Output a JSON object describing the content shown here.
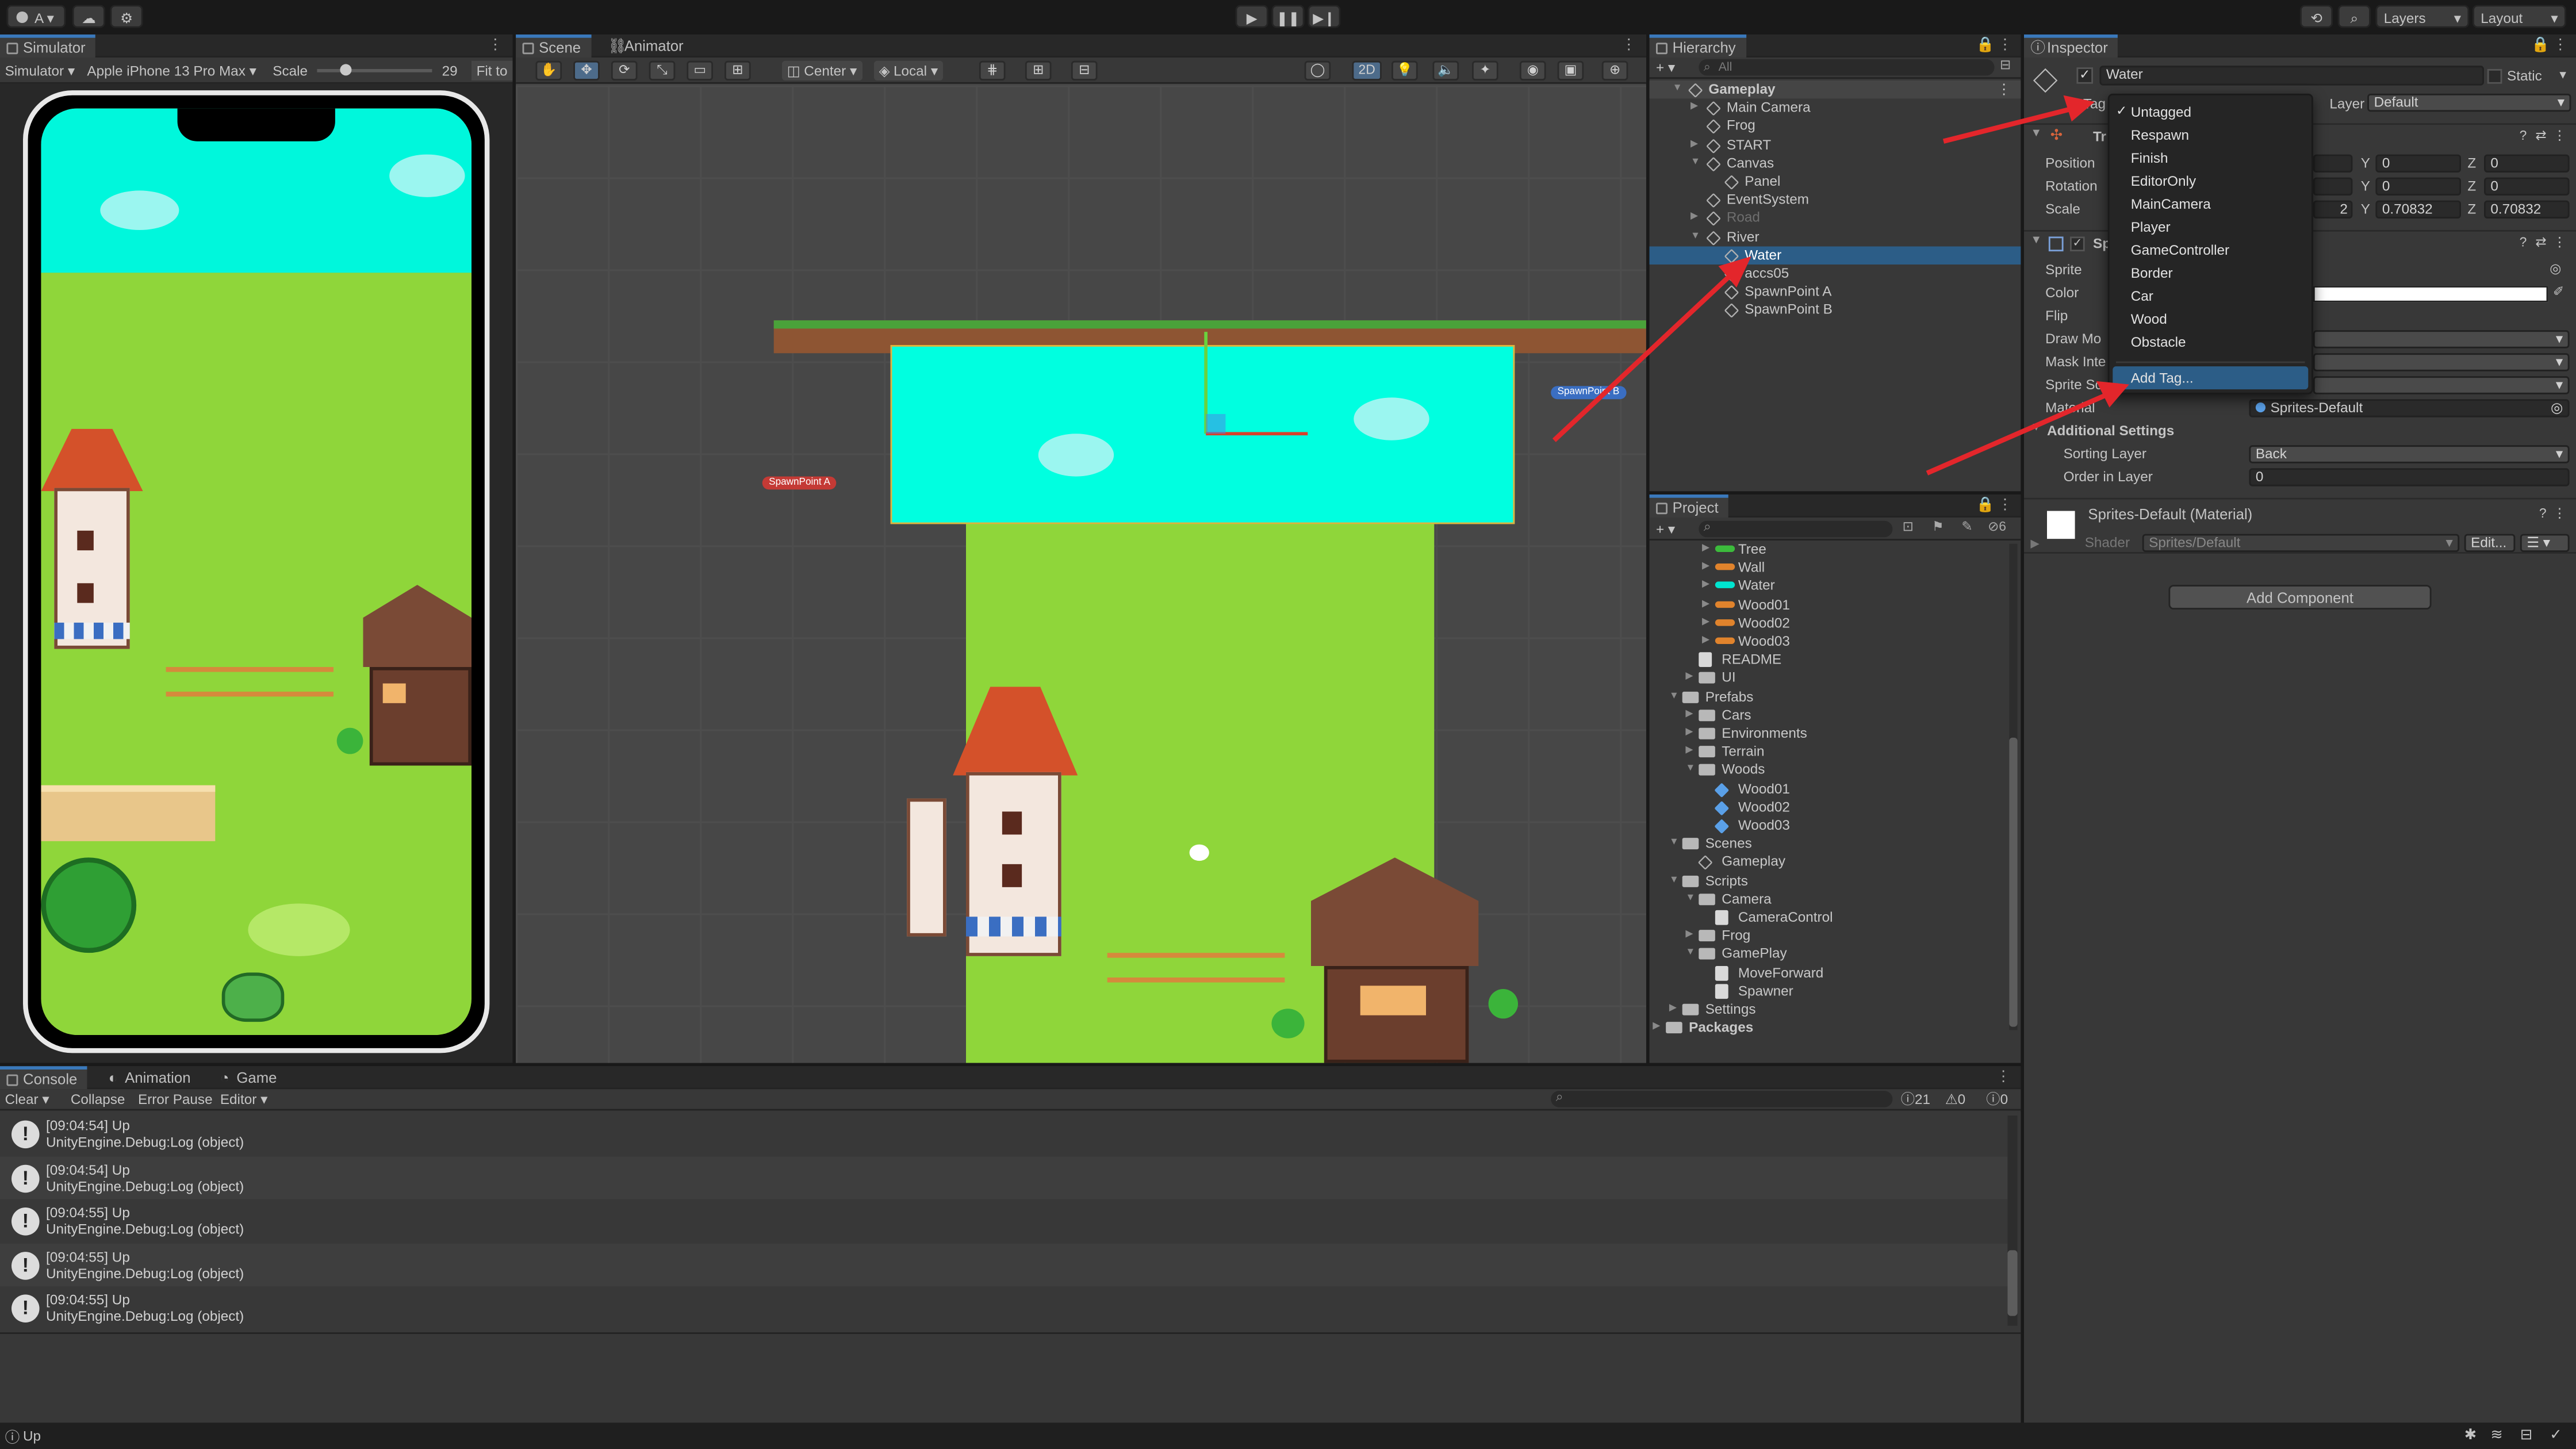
{
  "toolbar": {
    "account": "A ▾",
    "layers": "Layers",
    "layout": "Layout"
  },
  "simulator": {
    "tab": "Simulator",
    "mode": "Simulator",
    "device": "Apple iPhone 13 Pro Max",
    "scale_label": "Scale",
    "scale_value": "29",
    "fit": "Fit to"
  },
  "scene": {
    "tabs": [
      "Scene",
      "Animator"
    ],
    "pivot": "Center",
    "space": "Local",
    "mode2d": "2D",
    "spawn_a": "SpawnPoint A",
    "spawn_b": "SpawnPoint B"
  },
  "hierarchy": {
    "tab": "Hierarchy",
    "search_placeholder": "All",
    "items": [
      {
        "label": "Gameplay",
        "depth": 0,
        "arrow": "▼",
        "icon": "scene",
        "selected": false,
        "bold": true
      },
      {
        "label": "Main Camera",
        "depth": 1,
        "arrow": "▶",
        "icon": "cube"
      },
      {
        "label": "Frog",
        "depth": 1,
        "arrow": "",
        "icon": "cube"
      },
      {
        "label": "START",
        "depth": 1,
        "arrow": "▶",
        "icon": "cube"
      },
      {
        "label": "Canvas",
        "depth": 1,
        "arrow": "▼",
        "icon": "cube"
      },
      {
        "label": "Panel",
        "depth": 2,
        "arrow": "",
        "icon": "cube"
      },
      {
        "label": "EventSystem",
        "depth": 1,
        "arrow": "",
        "icon": "cube"
      },
      {
        "label": "Road",
        "depth": 1,
        "arrow": "▶",
        "icon": "cube",
        "dim": true
      },
      {
        "label": "River",
        "depth": 1,
        "arrow": "▼",
        "icon": "cube"
      },
      {
        "label": "Water",
        "depth": 2,
        "arrow": "",
        "icon": "cube",
        "selected": true
      },
      {
        "label": "accs05",
        "depth": 2,
        "arrow": "",
        "icon": "cube"
      },
      {
        "label": "SpawnPoint A",
        "depth": 2,
        "arrow": "",
        "icon": "cube"
      },
      {
        "label": "SpawnPoint B",
        "depth": 2,
        "arrow": "",
        "icon": "cube"
      }
    ]
  },
  "project": {
    "tab": "Project",
    "hidden_count": "6",
    "items": [
      {
        "label": "Tree",
        "depth": 3,
        "icon": "tree"
      },
      {
        "label": "Wall",
        "depth": 3,
        "icon": "wall"
      },
      {
        "label": "Water",
        "depth": 3,
        "icon": "water"
      },
      {
        "label": "Wood01",
        "depth": 3,
        "icon": "wood"
      },
      {
        "label": "Wood02",
        "depth": 3,
        "icon": "wood"
      },
      {
        "label": "Wood03",
        "depth": 3,
        "icon": "wood"
      },
      {
        "label": "README",
        "depth": 2,
        "icon": "file"
      },
      {
        "label": "UI",
        "depth": 2,
        "icon": "folder"
      },
      {
        "label": "Prefabs",
        "depth": 1,
        "icon": "folder"
      },
      {
        "label": "Cars",
        "depth": 2,
        "icon": "folder"
      },
      {
        "label": "Environments",
        "depth": 2,
        "icon": "folder"
      },
      {
        "label": "Terrain",
        "depth": 2,
        "icon": "folder"
      },
      {
        "label": "Woods",
        "depth": 2,
        "icon": "folder"
      },
      {
        "label": "Wood01",
        "depth": 3,
        "icon": "prefab"
      },
      {
        "label": "Wood02",
        "depth": 3,
        "icon": "prefab"
      },
      {
        "label": "Wood03",
        "depth": 3,
        "icon": "prefab"
      },
      {
        "label": "Scenes",
        "depth": 1,
        "icon": "folder"
      },
      {
        "label": "Gameplay",
        "depth": 2,
        "icon": "scene"
      },
      {
        "label": "Scripts",
        "depth": 1,
        "icon": "folder"
      },
      {
        "label": "Camera",
        "depth": 2,
        "icon": "folder"
      },
      {
        "label": "CameraControl",
        "depth": 3,
        "icon": "script"
      },
      {
        "label": "Frog",
        "depth": 2,
        "icon": "folder"
      },
      {
        "label": "GamePlay",
        "depth": 2,
        "icon": "folder"
      },
      {
        "label": "MoveForward",
        "depth": 3,
        "icon": "script"
      },
      {
        "label": "Spawner",
        "depth": 3,
        "icon": "script"
      },
      {
        "label": "Settings",
        "depth": 1,
        "icon": "folder"
      },
      {
        "label": "Packages",
        "depth": 0,
        "icon": "folder",
        "bold": true
      }
    ]
  },
  "inspector": {
    "tab": "Inspector",
    "object_name": "Water",
    "static": "Static",
    "tag_label": "Tag",
    "layer_label": "Layer",
    "layer_value": "Default",
    "transform_title": "Tr",
    "position_label": "Position",
    "rotation_label": "Rotation",
    "scale_label": "Scale",
    "pos": {
      "y": "0",
      "z": "0"
    },
    "rot": {
      "y": "0",
      "z": "0"
    },
    "scl": {
      "x_tail": "2",
      "y": "0.70832",
      "z": "0.70832"
    },
    "sprite_title": "Sp",
    "sprite_label": "Sprite",
    "color_label": "Color",
    "flip_label": "Flip",
    "draw_mode_label": "Draw Mo",
    "mask_label": "Mask Inte",
    "sort_label": "Sprite So",
    "material_label": "Material",
    "material_value": "Sprites-Default",
    "additional": "Additional Settings",
    "sorting_layer_label": "Sorting Layer",
    "sorting_layer_value": "Back",
    "order_label": "Order in Layer",
    "order_value": "0",
    "mat_title": "Sprites-Default (Material)",
    "shader_label": "Shader",
    "shader_value": "Sprites/Default",
    "edit": "Edit...",
    "add_component": "Add Component"
  },
  "tag_dropdown": {
    "items": [
      "Untagged",
      "Respawn",
      "Finish",
      "EditorOnly",
      "MainCamera",
      "Player",
      "GameController",
      "Border",
      "Car",
      "Wood",
      "Obstacle"
    ],
    "checked": "Untagged",
    "add": "Add Tag..."
  },
  "console": {
    "tabs": [
      "Console",
      "Animation",
      "Game"
    ],
    "clear": "Clear",
    "collapse": "Collapse",
    "error_pause": "Error Pause",
    "editor": "Editor",
    "counts": {
      "log": "21",
      "warn": "0",
      "error": "0"
    },
    "entries": [
      {
        "time": "[09:04:54] Up",
        "source": "UnityEngine.Debug:Log (object)"
      },
      {
        "time": "[09:04:54] Up",
        "source": "UnityEngine.Debug:Log (object)"
      },
      {
        "time": "[09:04:55] Up",
        "source": "UnityEngine.Debug:Log (object)"
      },
      {
        "time": "[09:04:55] Up",
        "source": "UnityEngine.Debug:Log (object)"
      },
      {
        "time": "[09:04:55] Up",
        "source": "UnityEngine.Debug:Log (object)"
      }
    ]
  },
  "status": {
    "message": "Up"
  },
  "colors": {
    "accent": "#2c5d87",
    "arrow": "#e3262b",
    "water": "#00ffe0",
    "grass": "#8fd63a"
  }
}
